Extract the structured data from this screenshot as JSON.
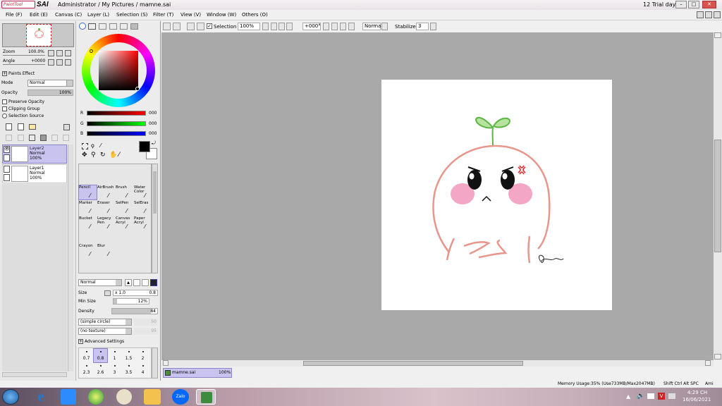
{
  "titlebar": {
    "logo_text": "PaintTool",
    "app_name": "SAI",
    "window_title": "Administrator / My Pictures / mamne.sai",
    "trial": "12 Trial day"
  },
  "menu": {
    "file": "File (F)",
    "edit": "Edit (E)",
    "canvas": "Canvas (C)",
    "layer": "Layer (L)",
    "selection": "Selection (S)",
    "filter": "Filter (T)",
    "view": "View (V)",
    "window": "Window (W)",
    "others": "Others (O)"
  },
  "toolbar": {
    "selection_label": "Selection",
    "zoom": "100%",
    "angle": "+000°",
    "mode": "Normal",
    "stabilizer_label": "Stabilizer",
    "stabilizer_value": "3"
  },
  "navigator": {
    "zoom_label": "Zoom",
    "zoom_value": "100.0%",
    "angle_label": "Angle",
    "angle_value": "+0000"
  },
  "layer_props": {
    "paints_effect": "Paints Effect",
    "mode_label": "Mode",
    "mode_value": "Normal",
    "opacity_label": "Opacity",
    "opacity_value": "100%",
    "opacity_fraction": 1.0,
    "preserve_opacity": "Preserve Opacity",
    "clipping_group": "Clipping Group",
    "selection_source": "Selection Source"
  },
  "layers": [
    {
      "name": "Layer2",
      "mode": "Normal",
      "opacity": "100%",
      "selected": true
    },
    {
      "name": "Layer1",
      "mode": "Normal",
      "opacity": "100%",
      "selected": false
    }
  ],
  "color": {
    "r_label": "R",
    "r_value": "000",
    "g_label": "G",
    "g_value": "000",
    "b_label": "B",
    "b_value": "000",
    "current": "#000000"
  },
  "tools": [
    {
      "name": "Pencil",
      "line2": ""
    },
    {
      "name": "AirBrush",
      "line2": ""
    },
    {
      "name": "Brush",
      "line2": ""
    },
    {
      "name": "Water",
      "line2": "Color"
    },
    {
      "name": "Marker",
      "line2": ""
    },
    {
      "name": "Eraser",
      "line2": ""
    },
    {
      "name": "SelPen",
      "line2": ""
    },
    {
      "name": "SelEras",
      "line2": ""
    },
    {
      "name": "Bucket",
      "line2": ""
    },
    {
      "name": "Legacy",
      "line2": "Pen"
    },
    {
      "name": "Canvas",
      "line2": "Acryl"
    },
    {
      "name": "Paper",
      "line2": "Acryl"
    },
    {
      "name": "Crayon",
      "line2": ""
    },
    {
      "name": "Blur",
      "line2": ""
    }
  ],
  "brush": {
    "blend_mode": "Normal",
    "size_label": "Size",
    "size_mult": "x 1.0",
    "size_value": "0.8",
    "min_size_label": "Min Size",
    "min_size_value": "12%",
    "density_label": "Density",
    "density_value": "84",
    "shape": "(simple circle)",
    "shape_value": "50",
    "texture": "(no texture)",
    "texture_value": "95",
    "advanced": "Advanced Settings",
    "sizes_row1": [
      "0.7",
      "0.8",
      "1",
      "1.5",
      "2"
    ],
    "sizes_row2": [
      "2.3",
      "2.6",
      "3",
      "3.5",
      "4"
    ]
  },
  "file_tab": {
    "name": "mamne.sai",
    "zoom": "100%"
  },
  "status": {
    "memory": "Memory Usage:35% (Use733MB/Max2047MB)",
    "keys": "Shift Ctrl Alt SPC",
    "ime": "Ami"
  },
  "taskbar": {
    "time": "4:29 CH",
    "date": "16/06/2021",
    "zalo": "Zalo"
  },
  "colors": {
    "accent": "#c9c4ef",
    "outline": "#e8958a",
    "blush": "#f3a6c5",
    "sprout": "#5bb544"
  }
}
